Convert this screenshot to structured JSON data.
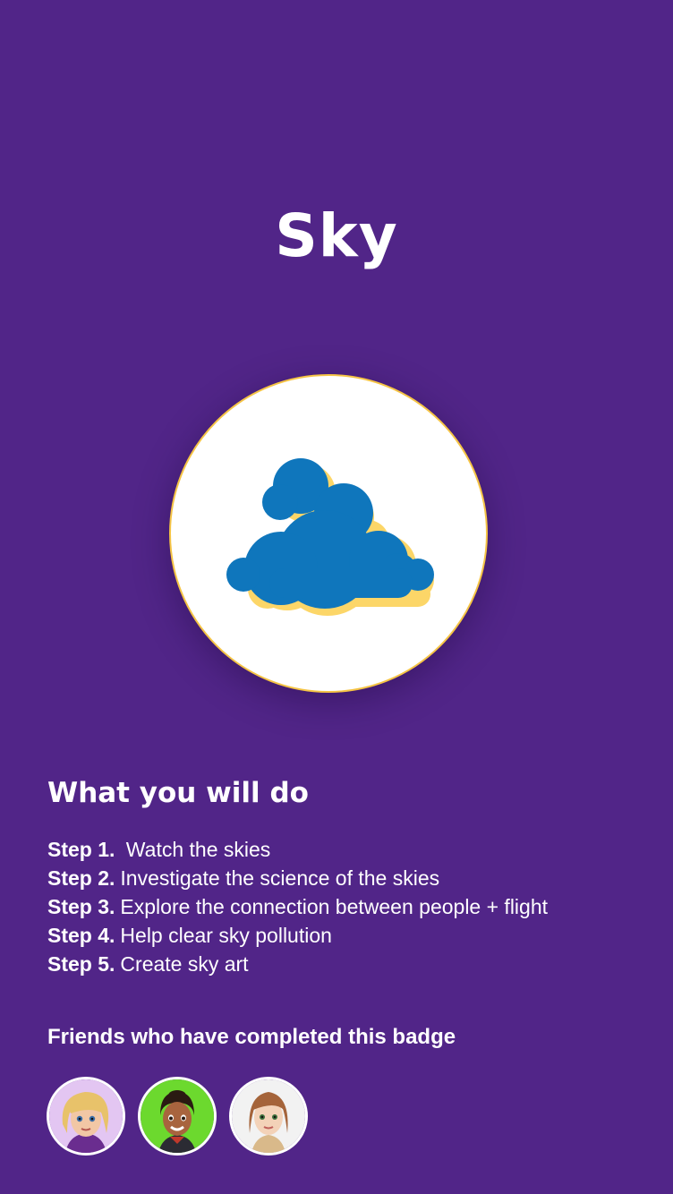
{
  "badge": {
    "title": "Sky",
    "icon": "cloud-icon",
    "colors": {
      "background": "#512588",
      "cloud": "#0f76bc",
      "cloud_shadow": "#fcd668",
      "ring": "#f5c445"
    }
  },
  "what_you_will_do": {
    "heading": "What you will do",
    "steps": [
      {
        "label": "Step 1.",
        "text": " Watch the skies"
      },
      {
        "label": "Step 2.",
        "text": "Investigate the science of the skies"
      },
      {
        "label": "Step 3.",
        "text": "Explore the connection between people + flight"
      },
      {
        "label": "Step 4.",
        "text": "Help clear sky pollution"
      },
      {
        "label": "Step 5.",
        "text": "Create sky art"
      }
    ]
  },
  "friends": {
    "heading": "Friends who have completed this badge",
    "avatars": [
      {
        "icon": "blonde-girl-avatar-icon",
        "bg": "#e3c6f2"
      },
      {
        "icon": "dark-hair-girl-avatar-icon",
        "bg": "#6cd92e"
      },
      {
        "icon": "auburn-hair-girl-avatar-icon",
        "bg": "#f2f2f2"
      }
    ]
  }
}
